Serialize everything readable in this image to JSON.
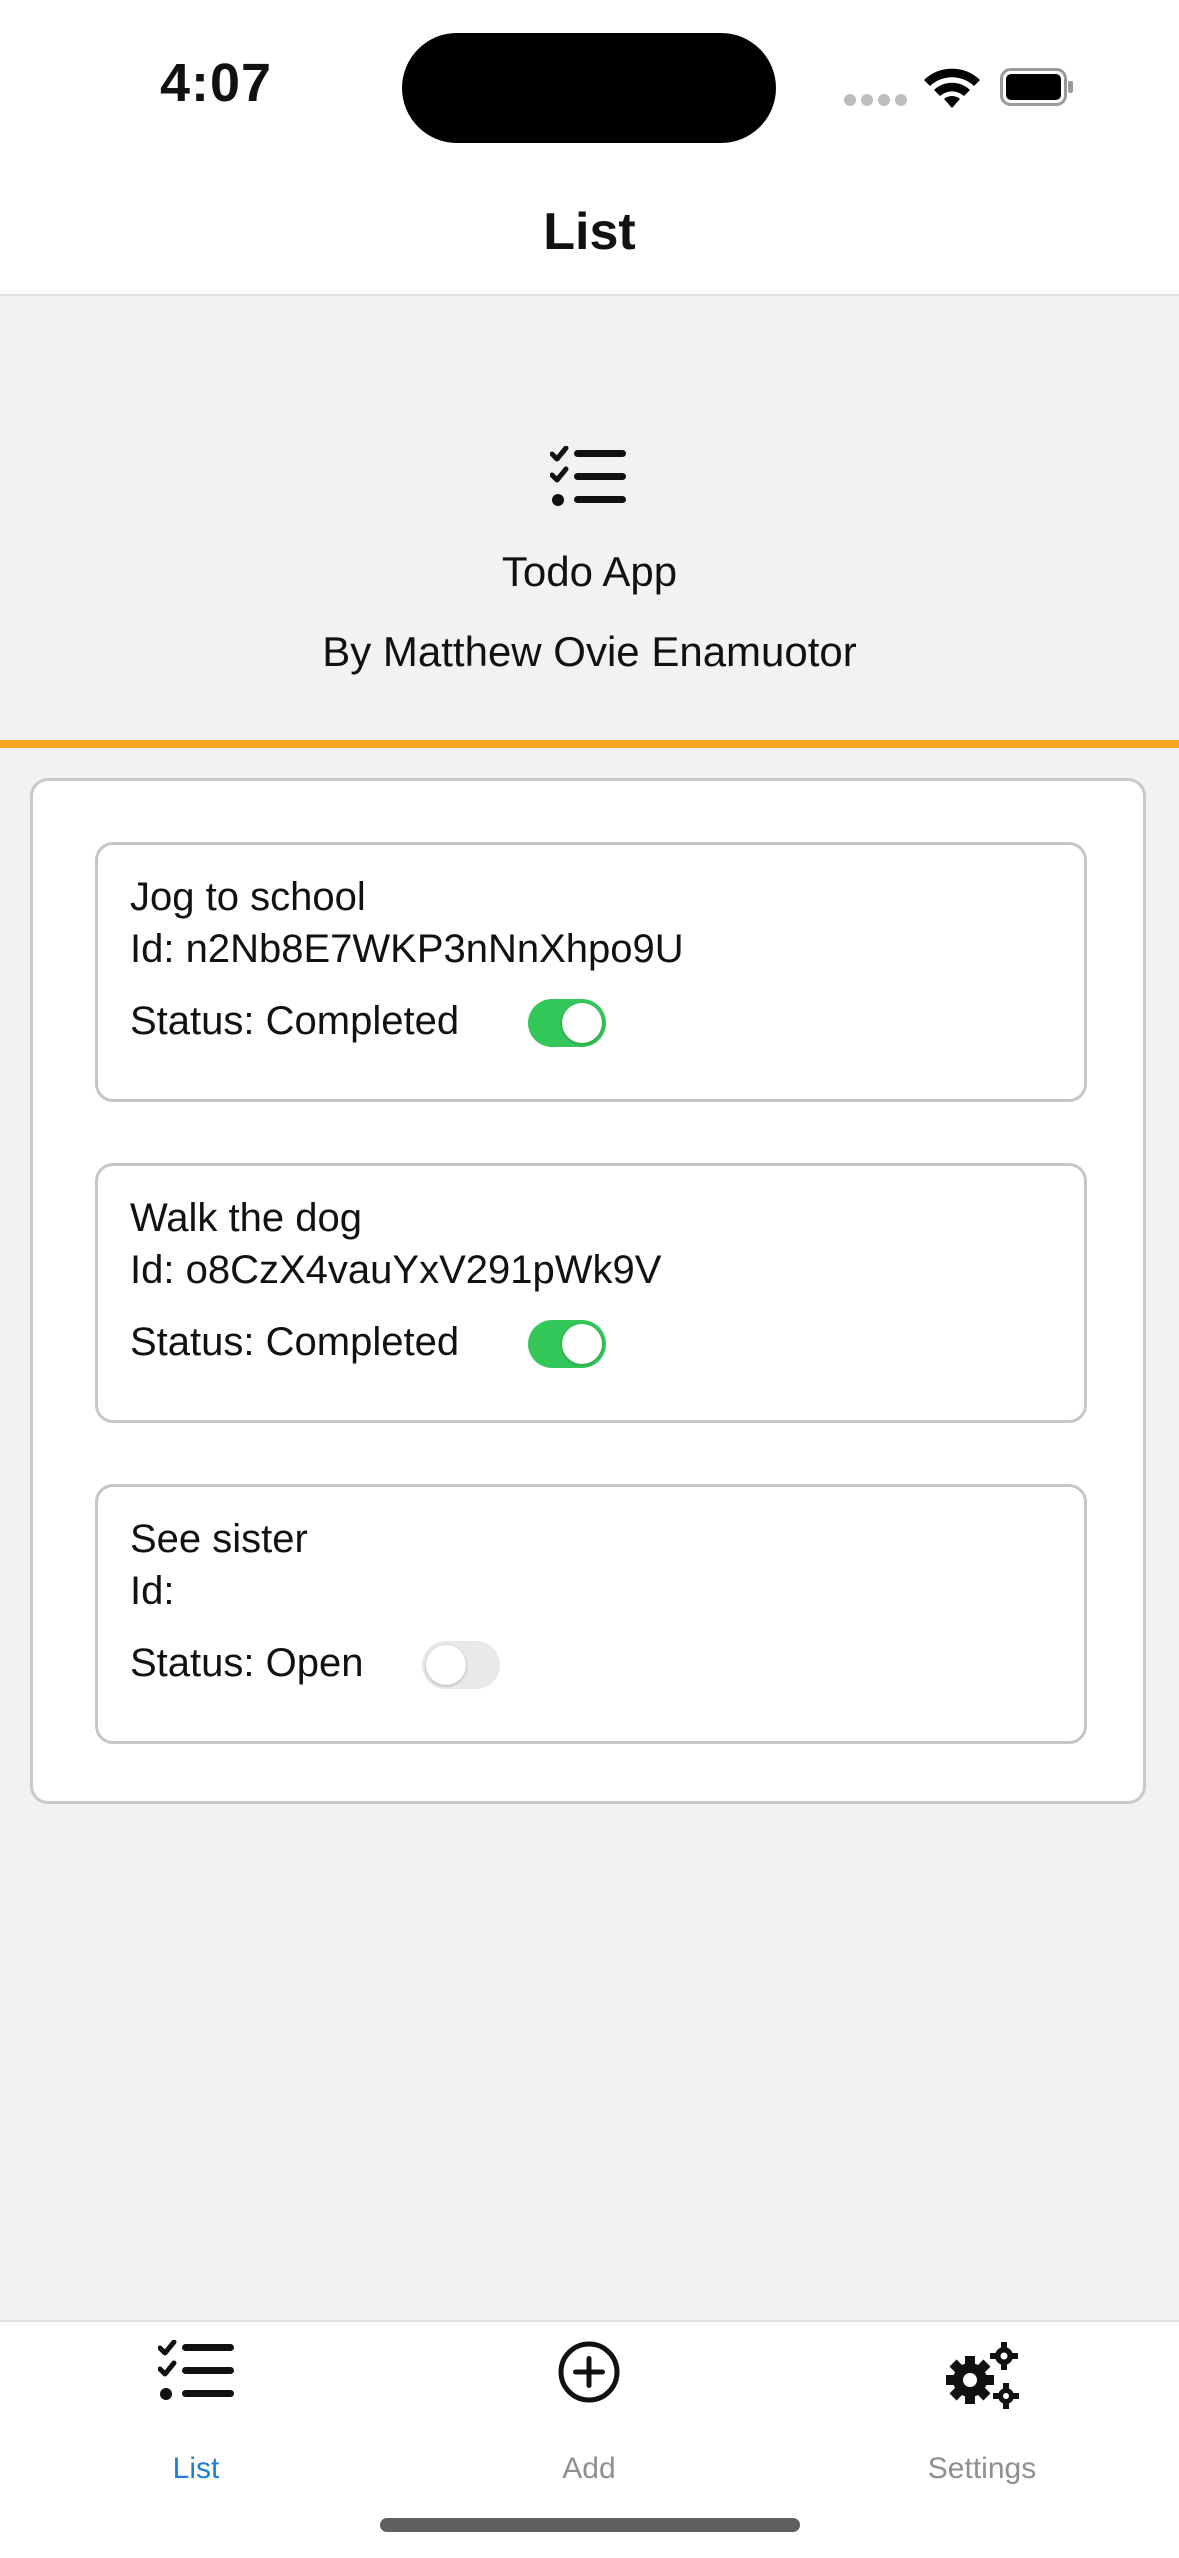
{
  "status_bar": {
    "time": "4:07"
  },
  "nav": {
    "title": "List"
  },
  "header": {
    "app_name": "Todo App",
    "author": "By Matthew Ovie Enamuotor",
    "icon": "checklist-icon"
  },
  "todos": [
    {
      "title": "Jog to school",
      "id_text": "Id: n2Nb8E7WKP3nNnXhpo9U",
      "status_text": "Status: Completed",
      "completed": true
    },
    {
      "title": "Walk the dog",
      "id_text": "Id: o8CzX4vauYxV291pWk9V",
      "status_text": "Status: Completed",
      "completed": true
    },
    {
      "title": "See sister",
      "id_text": "Id:",
      "status_text": "Status: Open",
      "completed": false
    }
  ],
  "tabs": [
    {
      "label": "List",
      "icon": "checklist-icon",
      "active": true
    },
    {
      "label": "Add",
      "icon": "plus-circle-icon",
      "active": false
    },
    {
      "label": "Settings",
      "icon": "gears-icon",
      "active": false
    }
  ],
  "colors": {
    "accent": "#f5a623",
    "toggle_on": "#34c759",
    "tab_active": "#1e7fd8",
    "tab_inactive": "#8e8e93"
  }
}
